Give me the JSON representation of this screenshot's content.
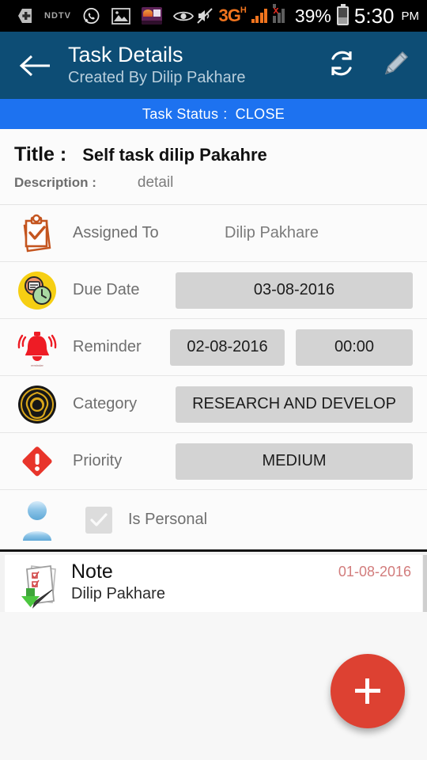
{
  "statusbar": {
    "left_icons": [
      "app-plus-icon",
      "ndtv-icon",
      "whatsapp-icon",
      "gallery-icon",
      "purple-app-icon",
      "eye-icon"
    ],
    "ndtv_label": "NDTV",
    "mute_icon": "mute-icon",
    "network_type": "3G",
    "network_speed_class": "H",
    "signal2_state": "x",
    "battery_percent": "39%",
    "time": "5:30",
    "ampm": "PM"
  },
  "appbar": {
    "back_icon": "back-arrow-icon",
    "title": "Task Details",
    "subtitle": "Created By Dilip Pakhare",
    "refresh_icon": "refresh-icon",
    "edit_icon": "pencil-icon",
    "bg_color": "#0d4d75"
  },
  "status_band": {
    "label": "Task Status",
    "separator": ":",
    "value": "CLOSE",
    "bg_color": "#1d72f0"
  },
  "details": {
    "title_label": "Title :",
    "title_value": "Self task dilip Pakahre",
    "description_label": "Description :",
    "description_value": "detail"
  },
  "rows": [
    {
      "name": "assigned-to",
      "icon": "clipboard-check-icon",
      "label": "Assigned To",
      "value": "Dilip Pakhare"
    },
    {
      "name": "due-date",
      "icon": "calendar-clock-icon",
      "label": "Due Date",
      "value": "03-08-2016"
    },
    {
      "name": "reminder",
      "icon": "alarm-bell-icon",
      "label": "Reminder",
      "date_value": "02-08-2016",
      "time_value": "00:00"
    },
    {
      "name": "category",
      "icon": "category-emblem-icon",
      "label": "Category",
      "value": "RESEARCH AND DEVELOP"
    },
    {
      "name": "priority",
      "icon": "priority-alert-icon",
      "label": "Priority",
      "value": "MEDIUM"
    }
  ],
  "personal": {
    "icon": "person-icon",
    "checkbox_icon": "checkmark-icon",
    "checked": true,
    "label": "Is Personal"
  },
  "note": {
    "icon": "note-download-icon",
    "title": "Note",
    "author": "Dilip Pakhare",
    "date": "01-08-2016",
    "date_color": "#d27c7c"
  },
  "fab": {
    "icon": "plus-icon",
    "color": "#dd4132"
  }
}
